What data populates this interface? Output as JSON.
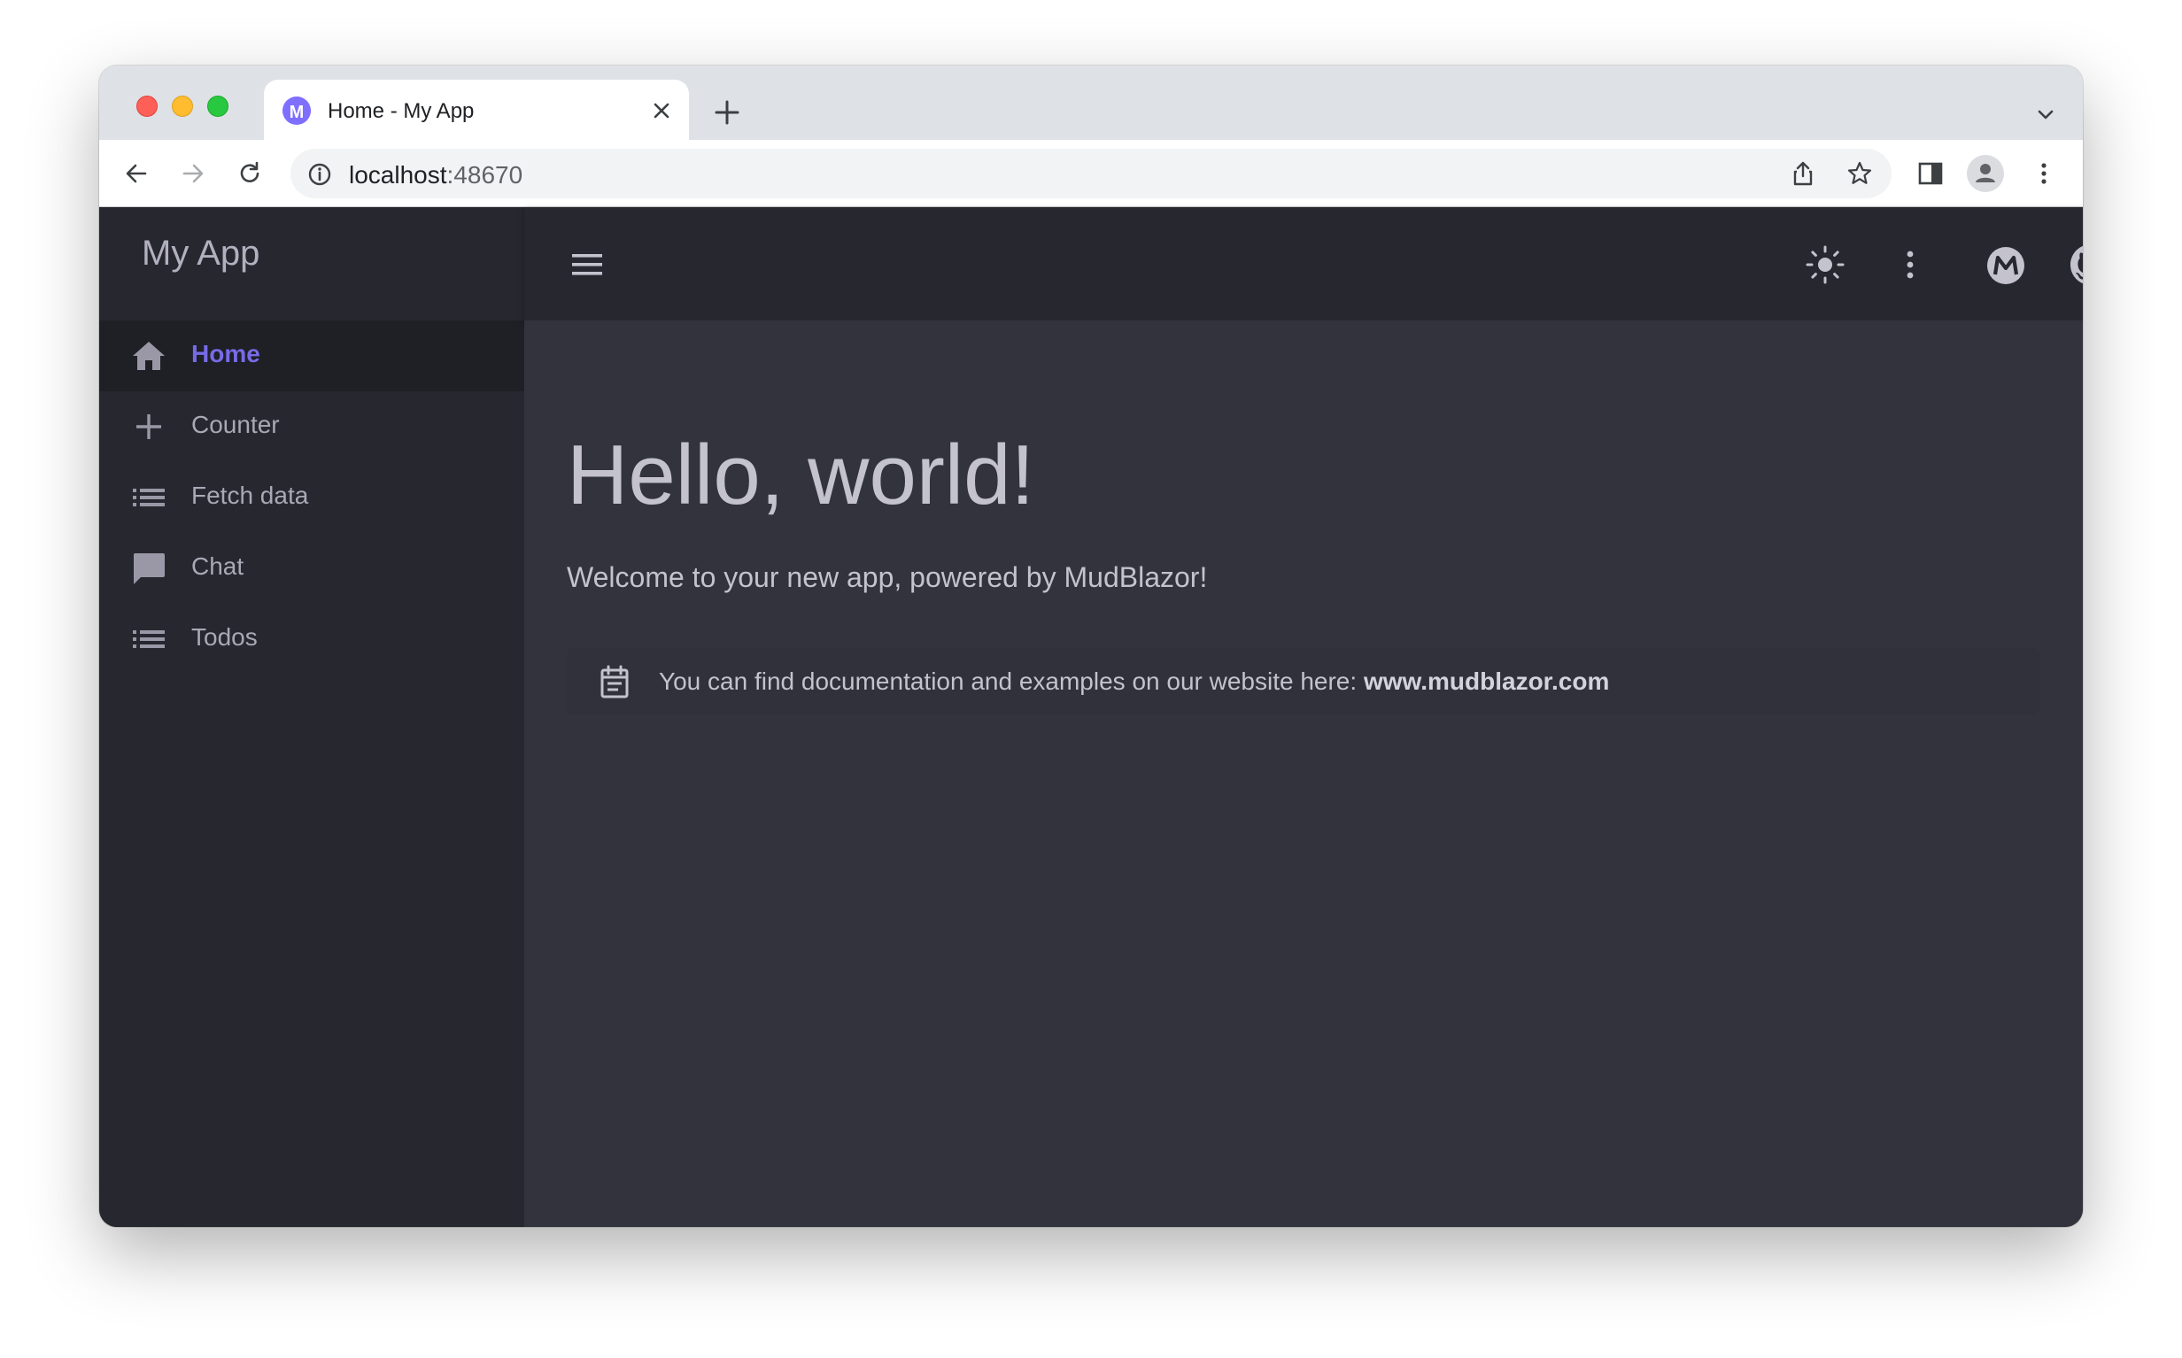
{
  "browser": {
    "tab_title": "Home - My App",
    "url_host": "localhost",
    "url_port": ":48670"
  },
  "app": {
    "title": "My App",
    "nav": [
      {
        "label": "Home",
        "icon": "home-icon",
        "active": true
      },
      {
        "label": "Counter",
        "icon": "plus-icon",
        "active": false
      },
      {
        "label": "Fetch data",
        "icon": "list-icon",
        "active": false
      },
      {
        "label": "Chat",
        "icon": "chat-icon",
        "active": false
      },
      {
        "label": "Todos",
        "icon": "list-icon",
        "active": false
      }
    ]
  },
  "main": {
    "heading": "Hello, world!",
    "welcome": "Welcome to your new app, powered by MudBlazor!",
    "alert_text": "You can find documentation and examples on our website here: ",
    "alert_link": "www.mudblazor.com"
  },
  "colors": {
    "accent": "#776be7",
    "drawer_bg": "#27272f",
    "main_bg": "#32333d"
  }
}
